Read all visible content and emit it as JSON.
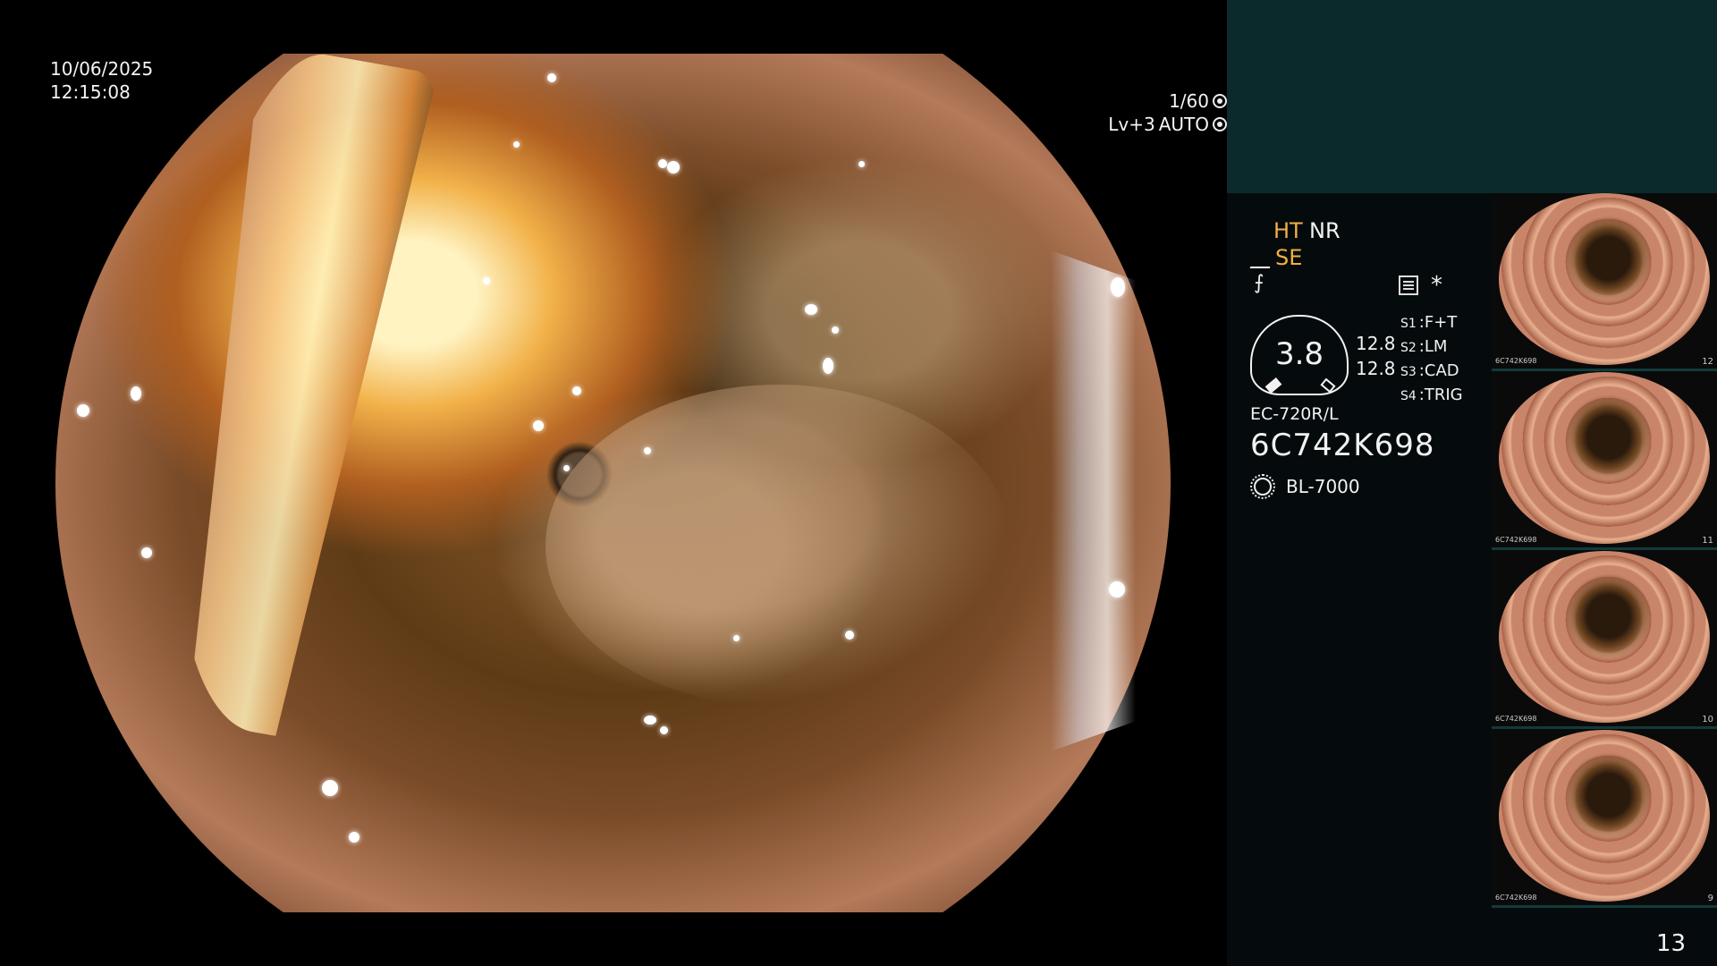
{
  "overlay": {
    "date": "10/06/2025",
    "time": "12:15:08",
    "shutter_speed": "1/60",
    "level": "Lv+3",
    "iris_mode": "AUTO"
  },
  "settings": {
    "ht": "HT",
    "nr": "NR",
    "se": "SE",
    "f_symbol": "⨍",
    "asterisk": "*",
    "gauge_value": "3.8",
    "readout_1": "12.8",
    "readout_2": "12.8",
    "switches": [
      {
        "key": "S1",
        "value": "F+T"
      },
      {
        "key": "S2",
        "value": "LM"
      },
      {
        "key": "S3",
        "value": "CAD"
      },
      {
        "key": "S4",
        "value": "TRIG"
      }
    ],
    "scope_model": "EC-720R/L",
    "scope_serial": "6C742K698",
    "light_source": "BL-7000"
  },
  "thumbnails": [
    {
      "num": "12",
      "serial": "6C742K698"
    },
    {
      "num": "11",
      "serial": "6C742K698"
    },
    {
      "num": "10",
      "serial": "6C742K698"
    },
    {
      "num": "9",
      "serial": "6C742K698"
    }
  ],
  "page_number": "13",
  "colors": {
    "accent": "#f0b044",
    "panel_top": "#0b2a2b",
    "panel_bg": "#050b0c"
  }
}
